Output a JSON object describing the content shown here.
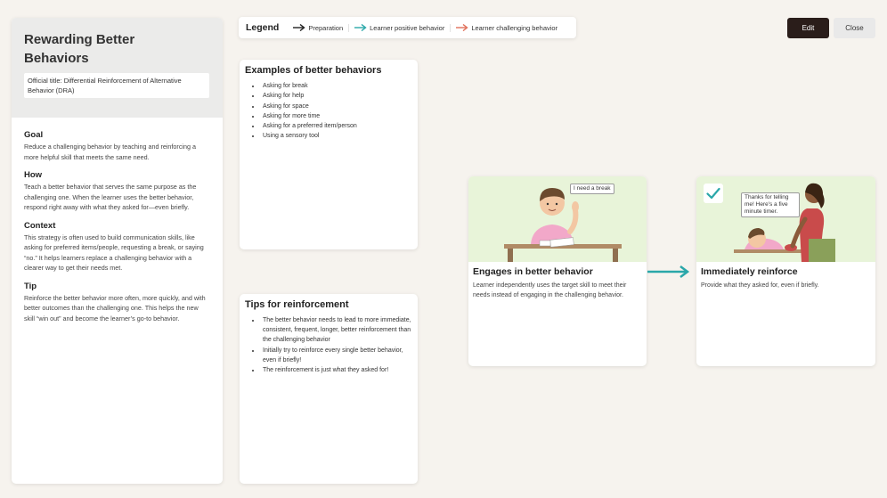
{
  "sidebar": {
    "title": "Rewarding Better Behaviors",
    "official_title": "Official title: Differential Reinforcement of Alternative Behavior (DRA)",
    "sections": [
      {
        "heading": "Goal",
        "text": "Reduce a challenging behavior by teaching and reinforcing a more helpful skill that meets the same need."
      },
      {
        "heading": "How",
        "text": "Teach a better behavior that serves the same purpose as the challenging one. When the learner uses the better behavior, respond right away with what they asked for—even briefly."
      },
      {
        "heading": "Context",
        "text": "This strategy is often used to build communication skills, like asking for preferred items/people, requesting a break, or saying “no.” It helps learners replace a challenging behavior with a clearer way to get their needs met."
      },
      {
        "heading": "Tip",
        "text": "Reinforce the better behavior more often, more quickly, and with better outcomes than the challenging one. This helps the new skill “win out” and become the learner’s go-to behavior."
      }
    ]
  },
  "legend": {
    "title": "Legend",
    "items": [
      {
        "label": "Preparation",
        "color": "#222222"
      },
      {
        "label": "Learner positive behavior",
        "color": "#2aa7a9"
      },
      {
        "label": "Learner challenging behavior",
        "color": "#e0705a"
      }
    ]
  },
  "toolbar": {
    "edit_label": "Edit",
    "close_label": "Close"
  },
  "examples": {
    "title": "Examples of better behaviors",
    "items": [
      "Asking for break",
      "Asking for help",
      "Asking for space",
      "Asking for more time",
      "Asking for a preferred item/person",
      "Using a sensory tool"
    ]
  },
  "tips": {
    "title": "Tips for reinforcement",
    "items": [
      "The better behavior needs to lead to more immediate, consistent, frequent, longer, better reinforcement than the challenging behavior",
      "Initially try to reinforce every single better behavior, even if briefly!",
      "The reinforcement is just what they asked for!"
    ]
  },
  "steps": [
    {
      "title": "Engages in better behavior",
      "text": "Learner independently uses the target skill to meet their needs instead of engaging in the challenging behavior.",
      "bubble": "I need a break",
      "icon": "learner-raising-hand-illustration"
    },
    {
      "title": "Immediately reinforce",
      "text": "Provide what they asked for, even if briefly.",
      "bubble": "Thanks for telling me! Here's a five minute timer.",
      "icon": "teacher-giving-timer-illustration"
    }
  ],
  "colors": {
    "background": "#f6f3ee",
    "illustration_bg": "#e8f4d9",
    "positive_arrow": "#2aa7a9",
    "edit_button": "#2a1d1a"
  }
}
